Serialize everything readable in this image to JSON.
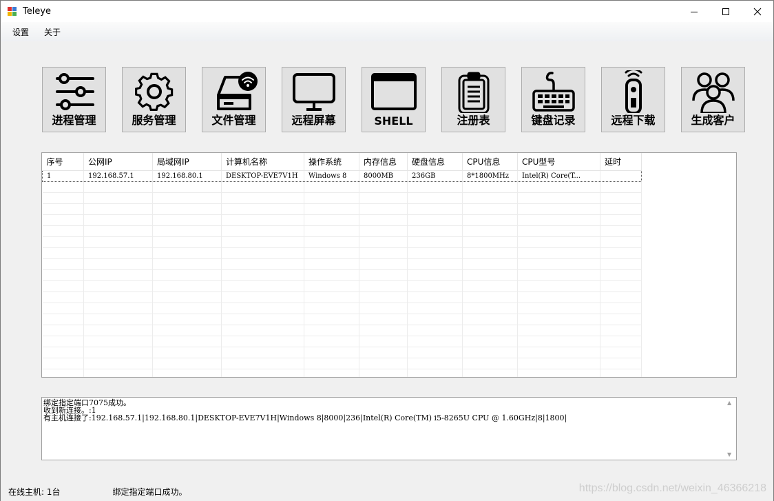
{
  "window": {
    "title": "Teleye",
    "minimize_glyph": "—",
    "maximize_glyph": "☐",
    "close_glyph": "✕"
  },
  "menu": [
    {
      "label": "设置"
    },
    {
      "label": "关于"
    }
  ],
  "toolbar": [
    {
      "label": "进程管理",
      "icon": "sliders-icon"
    },
    {
      "label": "服务管理",
      "icon": "gear-icon"
    },
    {
      "label": "文件管理",
      "icon": "hard-drive-wifi-icon"
    },
    {
      "label": "远程屏幕",
      "icon": "monitor-icon"
    },
    {
      "label": "SHELL",
      "icon": "terminal-window-icon"
    },
    {
      "label": "注册表",
      "icon": "clipboard-icon"
    },
    {
      "label": "键盘记录",
      "icon": "keyboard-icon"
    },
    {
      "label": "远程下载",
      "icon": "remote-control-icon"
    },
    {
      "label": "生成客户",
      "icon": "users-icon"
    }
  ],
  "table": {
    "columns": [
      "序号",
      "公网IP",
      "局域网IP",
      "计算机名称",
      "操作系统",
      "内存信息",
      "硬盘信息",
      "CPU信息",
      "CPU型号",
      "延时"
    ],
    "rows": [
      [
        "1",
        "192.168.57.1",
        "192.168.80.1",
        "DESKTOP-EVE7V1H",
        "Windows 8",
        "8000MB",
        "236GB",
        "8*1800MHz",
        "Intel(R) Core(T...",
        ""
      ]
    ]
  },
  "log": [
    "绑定指定端口7075成功。",
    "收到新连接。:1",
    "有主机连接了:192.168.57.1|192.168.80.1|DESKTOP-EVE7V1H|Windows 8|8000|236|Intel(R) Core(TM) i5-8265U CPU @ 1.60GHz|8|1800|"
  ],
  "log_scroll": {
    "up": "▲",
    "down": "▼"
  },
  "status": {
    "online": "在线主机: 1台",
    "message": "绑定指定端口成功。"
  },
  "watermark": "https://blog.csdn.net/weixin_46366218",
  "colors": {
    "accent": "#000000",
    "grid_line": "#ececec",
    "toolbar_bg": "#e1e1e1"
  }
}
